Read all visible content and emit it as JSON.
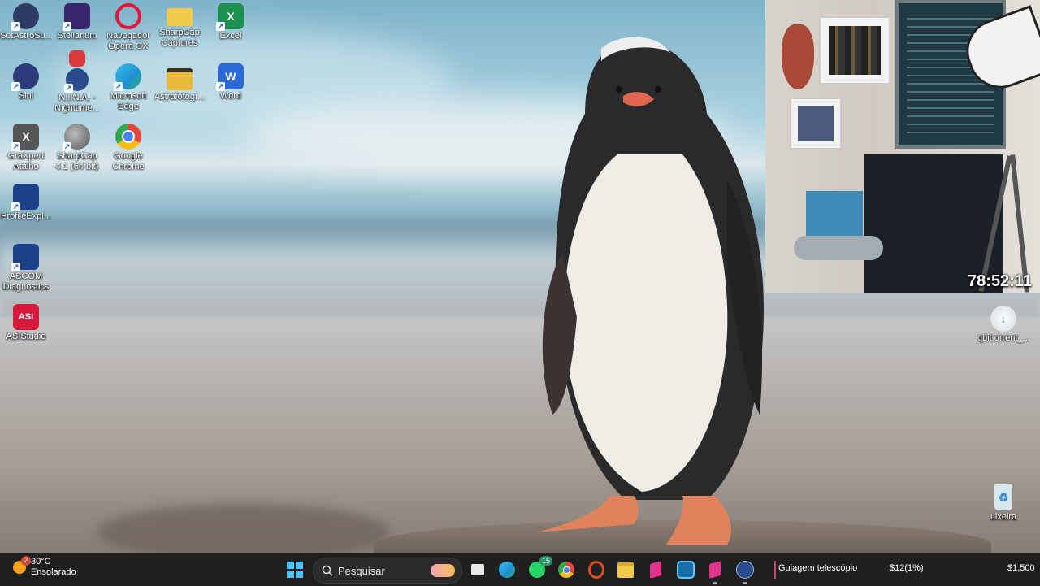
{
  "desktop": {
    "icons": [
      {
        "label": "SetAstroSu...",
        "icon": "setastro-icon",
        "color": "#2b3b63"
      },
      {
        "label": "Stellarium",
        "icon": "stellarium-icon",
        "color": "#37266b"
      },
      {
        "label": "Navegador Opera GX",
        "icon": "opera-gx-icon",
        "color": "#e0163b"
      },
      {
        "label": "SharpCap Captures",
        "icon": "folder-icon",
        "color": "#f2c94c"
      },
      {
        "label": "Excel",
        "icon": "excel-icon",
        "color": "#1d8f4f"
      },
      {
        "label": "Siril",
        "icon": "siril-icon",
        "color": "#2c3c7a"
      },
      {
        "label": "N.I.N.A. - Nighttime...",
        "icon": "nina-icon",
        "color": "#2a4c8c"
      },
      {
        "label": "Microsoft Edge",
        "icon": "edge-icon",
        "color": "#1f8fd1"
      },
      {
        "label": "Astrofotogr...",
        "icon": "folder-icon",
        "color": "#e9b93f"
      },
      {
        "label": "Word",
        "icon": "word-icon",
        "color": "#2b69d6"
      },
      {
        "label": "GraXpert Atalho",
        "icon": "graxpert-icon",
        "color": "#555555"
      },
      {
        "label": "SharpCap 4.1 (64 bit)",
        "icon": "sharpcap-icon",
        "color": "#7d7d7d"
      },
      {
        "label": "Google Chrome",
        "icon": "chrome-icon",
        "color": "#e8453c"
      },
      {
        "label": "ProfileExpl...",
        "icon": "ascom-profile-icon",
        "color": "#1c3f8a"
      },
      {
        "label": "ASCOM Diagnostics",
        "icon": "ascom-diagnostics-icon",
        "color": "#1c3f8a"
      },
      {
        "label": "ASIStudio",
        "icon": "asistudio-icon",
        "color": "#d7193c",
        "glyph_text": "ASI"
      },
      {
        "label": "qbittorrent_...",
        "icon": "qbittorrent-icon",
        "color": "#e8e8e8"
      },
      {
        "label": "Lixeira",
        "icon": "recycle-bin-icon",
        "color": "#d8e6ee"
      }
    ]
  },
  "webcam": {
    "timer": "78:52:11"
  },
  "taskbar": {
    "weather": {
      "temp": "30°C",
      "condition": "Ensolarado",
      "badge": "2"
    },
    "search_placeholder": "Pesquisar",
    "whatsapp_badge": "15",
    "ticker_label": "Guiagem telescópio",
    "ticker_value_1": "$12(1%)",
    "ticker_value_2": "$1,500"
  }
}
